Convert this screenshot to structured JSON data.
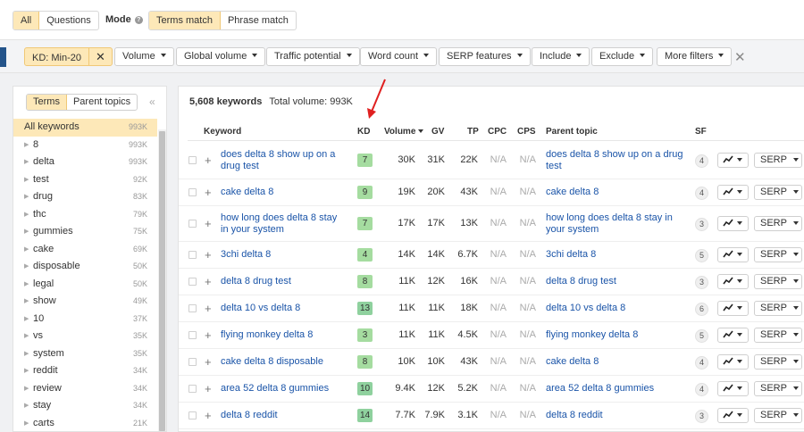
{
  "top": {
    "scope_all": "All",
    "scope_questions": "Questions",
    "mode_label": "Mode",
    "mode_terms": "Terms match",
    "mode_phrase": "Phrase match"
  },
  "filters": {
    "active_kd": "KD: Min-20",
    "items": [
      "Volume",
      "Global volume",
      "Traffic potential",
      "Word count",
      "SERP features",
      "Include",
      "Exclude",
      "More filters"
    ]
  },
  "sidebar": {
    "tab_terms": "Terms",
    "tab_parent": "Parent topics",
    "all_label": "All keywords",
    "all_count": "993K",
    "items": [
      {
        "label": "8",
        "count": "993K"
      },
      {
        "label": "delta",
        "count": "993K"
      },
      {
        "label": "test",
        "count": "92K"
      },
      {
        "label": "drug",
        "count": "83K"
      },
      {
        "label": "thc",
        "count": "79K"
      },
      {
        "label": "gummies",
        "count": "75K"
      },
      {
        "label": "cake",
        "count": "69K"
      },
      {
        "label": "disposable",
        "count": "50K"
      },
      {
        "label": "legal",
        "count": "50K"
      },
      {
        "label": "show",
        "count": "49K"
      },
      {
        "label": "10",
        "count": "37K"
      },
      {
        "label": "vs",
        "count": "35K"
      },
      {
        "label": "system",
        "count": "35K"
      },
      {
        "label": "reddit",
        "count": "34K"
      },
      {
        "label": "review",
        "count": "34K"
      },
      {
        "label": "stay",
        "count": "34K"
      },
      {
        "label": "carts",
        "count": "21K"
      }
    ]
  },
  "summary": {
    "keywords": "5,608 keywords",
    "total_volume": "Total volume: 993K"
  },
  "table": {
    "headers": {
      "keyword": "Keyword",
      "kd": "KD",
      "volume": "Volume",
      "gv": "GV",
      "tp": "TP",
      "cpc": "CPC",
      "cps": "CPS",
      "parent": "Parent topic",
      "sf": "SF"
    },
    "serp_label": "SERP",
    "kd_colors": {
      "low": "#a5dca0",
      "mid": "#8fd19e"
    },
    "rows": [
      {
        "keyword": "does delta 8 show up on a drug test",
        "kd": "7",
        "volume": "30K",
        "gv": "31K",
        "tp": "22K",
        "cpc": "N/A",
        "cps": "N/A",
        "parent": "does delta 8 show up on a drug test",
        "sf": "4"
      },
      {
        "keyword": "cake delta 8",
        "kd": "9",
        "volume": "19K",
        "gv": "20K",
        "tp": "43K",
        "cpc": "N/A",
        "cps": "N/A",
        "parent": "cake delta 8",
        "sf": "4"
      },
      {
        "keyword": "how long does delta 8 stay in your system",
        "kd": "7",
        "volume": "17K",
        "gv": "17K",
        "tp": "13K",
        "cpc": "N/A",
        "cps": "N/A",
        "parent": "how long does delta 8 stay in your system",
        "sf": "3"
      },
      {
        "keyword": "3chi delta 8",
        "kd": "4",
        "volume": "14K",
        "gv": "14K",
        "tp": "6.7K",
        "cpc": "N/A",
        "cps": "N/A",
        "parent": "3chi delta 8",
        "sf": "5"
      },
      {
        "keyword": "delta 8 drug test",
        "kd": "8",
        "volume": "11K",
        "gv": "12K",
        "tp": "16K",
        "cpc": "N/A",
        "cps": "N/A",
        "parent": "delta 8 drug test",
        "sf": "3"
      },
      {
        "keyword": "delta 10 vs delta 8",
        "kd": "13",
        "volume": "11K",
        "gv": "11K",
        "tp": "18K",
        "cpc": "N/A",
        "cps": "N/A",
        "parent": "delta 10 vs delta 8",
        "sf": "6"
      },
      {
        "keyword": "flying monkey delta 8",
        "kd": "3",
        "volume": "11K",
        "gv": "11K",
        "tp": "4.5K",
        "cpc": "N/A",
        "cps": "N/A",
        "parent": "flying monkey delta 8",
        "sf": "5"
      },
      {
        "keyword": "cake delta 8 disposable",
        "kd": "8",
        "volume": "10K",
        "gv": "10K",
        "tp": "43K",
        "cpc": "N/A",
        "cps": "N/A",
        "parent": "cake delta 8",
        "sf": "4"
      },
      {
        "keyword": "area 52 delta 8 gummies",
        "kd": "10",
        "volume": "9.4K",
        "gv": "12K",
        "tp": "5.2K",
        "cpc": "N/A",
        "cps": "N/A",
        "parent": "area 52 delta 8 gummies",
        "sf": "4"
      },
      {
        "keyword": "delta 8 reddit",
        "kd": "14",
        "volume": "7.7K",
        "gv": "7.9K",
        "tp": "3.1K",
        "cpc": "N/A",
        "cps": "N/A",
        "parent": "delta 8 reddit",
        "sf": "3"
      }
    ]
  },
  "colors": {
    "accent_bg": "#fde8b8",
    "link": "#1a54a8",
    "annotation_arrow": "#e02020"
  }
}
